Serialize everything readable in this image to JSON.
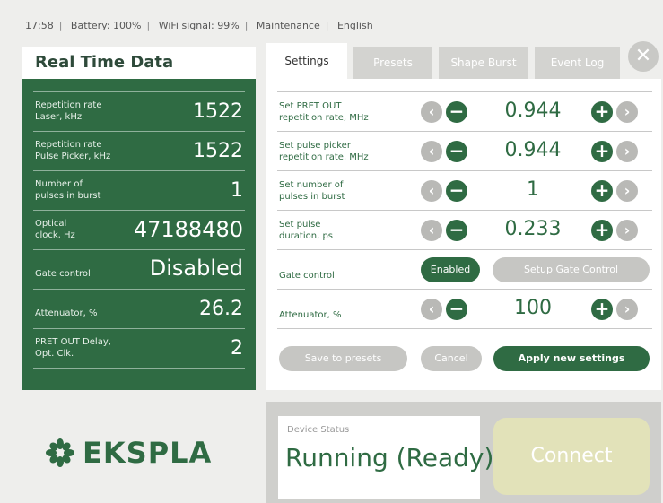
{
  "status_bar": {
    "time": "17:58",
    "battery": "Battery:  100%",
    "wifi": "WiFi signal:   99%",
    "mode": "Maintenance",
    "language": "English"
  },
  "realtime": {
    "title": "Real Time Data",
    "rows": [
      {
        "label1": "Repetition rate",
        "label2": "Laser, kHz",
        "value": "1522"
      },
      {
        "label1": "Repetition rate",
        "label2": "Pulse Picker, kHz",
        "value": "1522"
      },
      {
        "label1": "Number of",
        "label2": "pulses in burst",
        "value": "1"
      },
      {
        "label1": "Optical",
        "label2": "clock, Hz",
        "value": "47188480"
      },
      {
        "label1": "",
        "label2": "Gate control",
        "value": "Disabled"
      },
      {
        "label1": "",
        "label2": "Attenuator, %",
        "value": "26.2"
      },
      {
        "label1": "PRET OUT Delay,",
        "label2": "Opt. Clk.",
        "value": "2"
      }
    ]
  },
  "logo": {
    "text": "EKSPLA"
  },
  "tabs": [
    "Settings",
    "Presets",
    "Shape Burst",
    "Event Log"
  ],
  "close_label": "✕",
  "settings": {
    "rows": [
      {
        "label1": "Set PRET OUT",
        "label2": "repetition rate, MHz",
        "value": "0.944"
      },
      {
        "label1": "Set pulse picker",
        "label2": "repetition rate, MHz",
        "value": "0.944"
      },
      {
        "label1": "Set number of",
        "label2": "pulses in burst",
        "value": "1"
      },
      {
        "label1": "Set pulse",
        "label2": "duration, ps",
        "value": "0.233"
      }
    ],
    "gate_label": "Gate control",
    "gate_enabled": "Enabled",
    "gate_setup": "Setup Gate Control",
    "attenuator_label": "Attenuator, %",
    "attenuator_value": "100",
    "save_presets": "Save to presets",
    "cancel": "Cancel",
    "apply": "Apply new settings"
  },
  "device": {
    "status_title": "Device Status",
    "status_value": "Running (Ready)",
    "connect": "Connect"
  },
  "colors": {
    "accent": "#2f6b43",
    "inactive": "#c6c6c3"
  }
}
